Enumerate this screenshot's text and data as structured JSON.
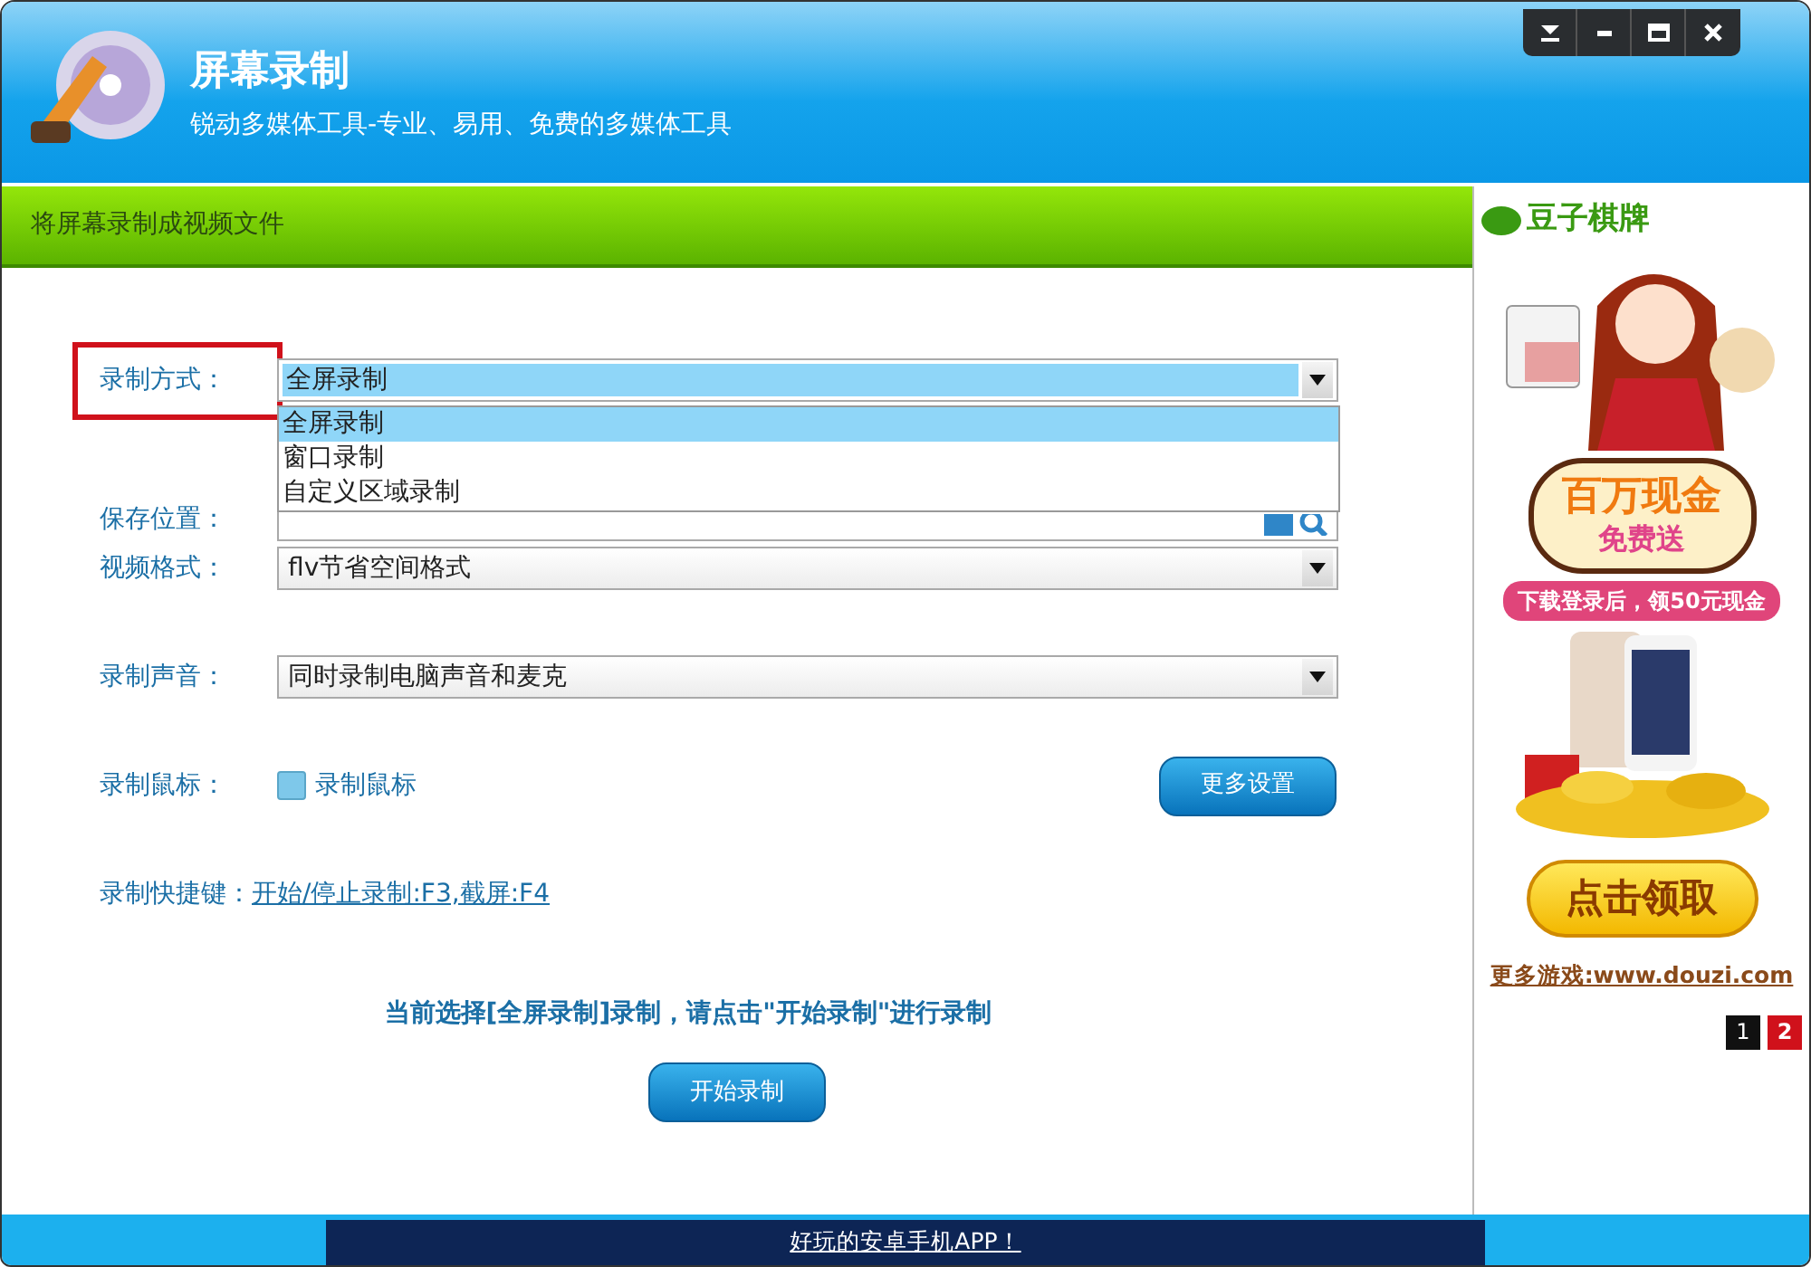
{
  "window": {
    "title": "屏幕录制",
    "subtitle": "锐动多媒体工具-专业、易用、免费的多媒体工具",
    "controls": [
      {
        "kind": "dropdown"
      },
      {
        "kind": "minimize"
      },
      {
        "kind": "maximize"
      },
      {
        "kind": "close"
      }
    ]
  },
  "section_title": "将屏幕录制成视频文件",
  "form": {
    "mode": {
      "label": "录制方式：",
      "value": "全屏录制",
      "highlighted": true,
      "expanded": true,
      "options": [
        {
          "label": "全屏录制",
          "selected": true
        },
        {
          "label": "窗口录制",
          "selected": false
        },
        {
          "label": "自定义区域录制",
          "selected": false
        }
      ]
    },
    "save_location": {
      "label": "保存位置："
    },
    "video_format": {
      "label": "视频格式：",
      "value": "flv节省空间格式"
    },
    "audio": {
      "label": "录制声音：",
      "value": "同时录制电脑声音和麦克"
    },
    "mouse": {
      "label": "录制鼠标：",
      "checkbox_label": "录制鼠标",
      "checked": false
    },
    "more_settings": "更多设置",
    "hotkeys": {
      "label": "录制快捷键：",
      "value": "开始/停止录制:F3,截屏:F4"
    }
  },
  "status_message": "当前选择[全屏录制]录制，请点击\"开始录制\"进行录制",
  "start_button": "开始录制",
  "ad": {
    "logo": "豆子棋牌",
    "headline": "百万现金",
    "subheadline": "免费送",
    "ribbon": "下载登录后，领50元现金",
    "cta": "点击领取",
    "more": "更多游戏:www.douzi.com",
    "pages": [
      {
        "label": "1",
        "selected": false
      },
      {
        "label": "2",
        "selected": true
      }
    ]
  },
  "footer": "好玩的安卓手机APP！"
}
